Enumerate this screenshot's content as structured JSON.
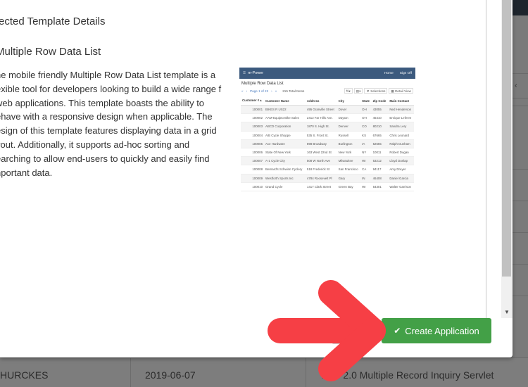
{
  "modal": {
    "section_title": "ected Template Details",
    "template_name": "Multiple Row Data List",
    "description": "he mobile friendly Multiple Row Data List template is a exible tool for developers looking to build a wide range f web applications. This template boasts the ability to ehave with a responsive design when applicable. The esign of this template features displaying data in a grid yout. Additionally, it supports ad-hoc sorting and earching to allow end-users to quickly and easily find nportant data.",
    "buttons": {
      "cancel_label": "",
      "create_label": "Create Application",
      "create_icon": "check-icon"
    }
  },
  "preview": {
    "brand": "m-Power",
    "nav_links": [
      "Home",
      "Sign Off"
    ],
    "title": "Multiple Row Data List",
    "pagination": {
      "first": "«",
      "prev": "‹",
      "page_label": "Page 1 of 22",
      "next": "›",
      "last": "»"
    },
    "total_items": "215 Total Items",
    "toolbar_buttons": [
      "⇅▾",
      "▤▾",
      "▼ Selections",
      "▦ Detail View"
    ],
    "columns": [
      "Customer # ▴",
      "Customer Name",
      "Address",
      "City",
      "State",
      "Zip Code",
      "Main Contact"
    ],
    "rows": [
      [
        "100001",
        "BIKES R US22",
        "495 Granville Street",
        "Dover",
        "OH",
        "43055",
        "Ned Henderson"
      ],
      [
        "100002",
        "AAM-Equipto Bike Sales",
        "2412 Far Hills Ave.",
        "Dayton",
        "OH",
        "45410",
        "Enrique Lefevre"
      ],
      [
        "100003",
        "ABCD Corporation",
        "1870 S. High St.",
        "Denver",
        "CO",
        "80210",
        "Sandra Lery"
      ],
      [
        "100004",
        "A/B Cycle Shoppe",
        "535 S. Front St.",
        "Russell",
        "KS",
        "67665",
        "Chris Leonard"
      ],
      [
        "100005",
        "Ace Hardware",
        "898 Broadway",
        "Burlington",
        "IA",
        "52655",
        "Ralph Dunham"
      ],
      [
        "100006",
        "State Of New York",
        "163 West 22nd St",
        "New York",
        "NY",
        "10011",
        "Robert Dugan"
      ],
      [
        "100007",
        "A-1 Cycle City",
        "508 W North Ave",
        "Milwaukee",
        "WI",
        "53212",
        "Lloyd Dunlap"
      ],
      [
        "100008",
        "Bernard's Schwinn Cyclery",
        "518 Frederick St",
        "San Francisco",
        "CA",
        "94117",
        "Amy Dreyer"
      ],
      [
        "100009",
        "Westforth Sports Inc",
        "4784 Roosevelt Pl",
        "Gary",
        "IN",
        "46408",
        "Daniel Garcia"
      ],
      [
        "100010",
        "Grand Cycle",
        "1417 Clark Street",
        "Green Bay",
        "WI",
        "54301",
        "Walter Garrison"
      ]
    ]
  },
  "background": {
    "row": [
      "HURCKES",
      "2019-06-07",
      "Web 2.0 Multiple Record Inquiry Servlet"
    ],
    "side_icon": "chevron-left-icon"
  },
  "annotation": {
    "arrow_color": "#f63f45",
    "icon": "arrow-right-icon"
  },
  "colors": {
    "create_button": "#43a047",
    "preview_nav": "#3c5a7e"
  }
}
